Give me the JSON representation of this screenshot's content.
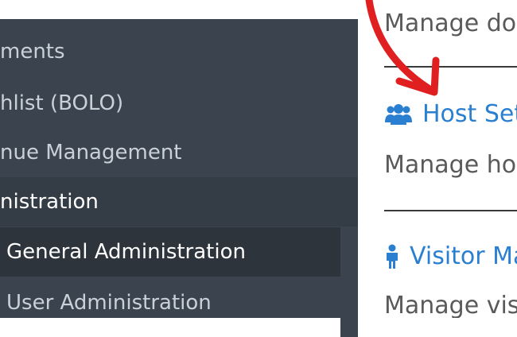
{
  "sidebar": {
    "items": [
      {
        "label": "ments"
      },
      {
        "label": "hlist (BOLO)"
      },
      {
        "label": "nue Management"
      },
      {
        "label": "nistration"
      },
      {
        "label": "General Administration"
      },
      {
        "label": "User Administration"
      }
    ]
  },
  "content": {
    "top_desc": "Manage doc",
    "sections": [
      {
        "title": "Host Set",
        "icon": "users-icon",
        "desc": "Manage hos"
      },
      {
        "title": "Visitor Ma",
        "icon": "person-icon",
        "desc": "Manage visi"
      }
    ]
  },
  "colors": {
    "sidebar_bg": "#3b444e",
    "sidebar_active_bg": "#343c45",
    "link": "#2a7fd0",
    "annotation_arrow": "#e02020"
  }
}
